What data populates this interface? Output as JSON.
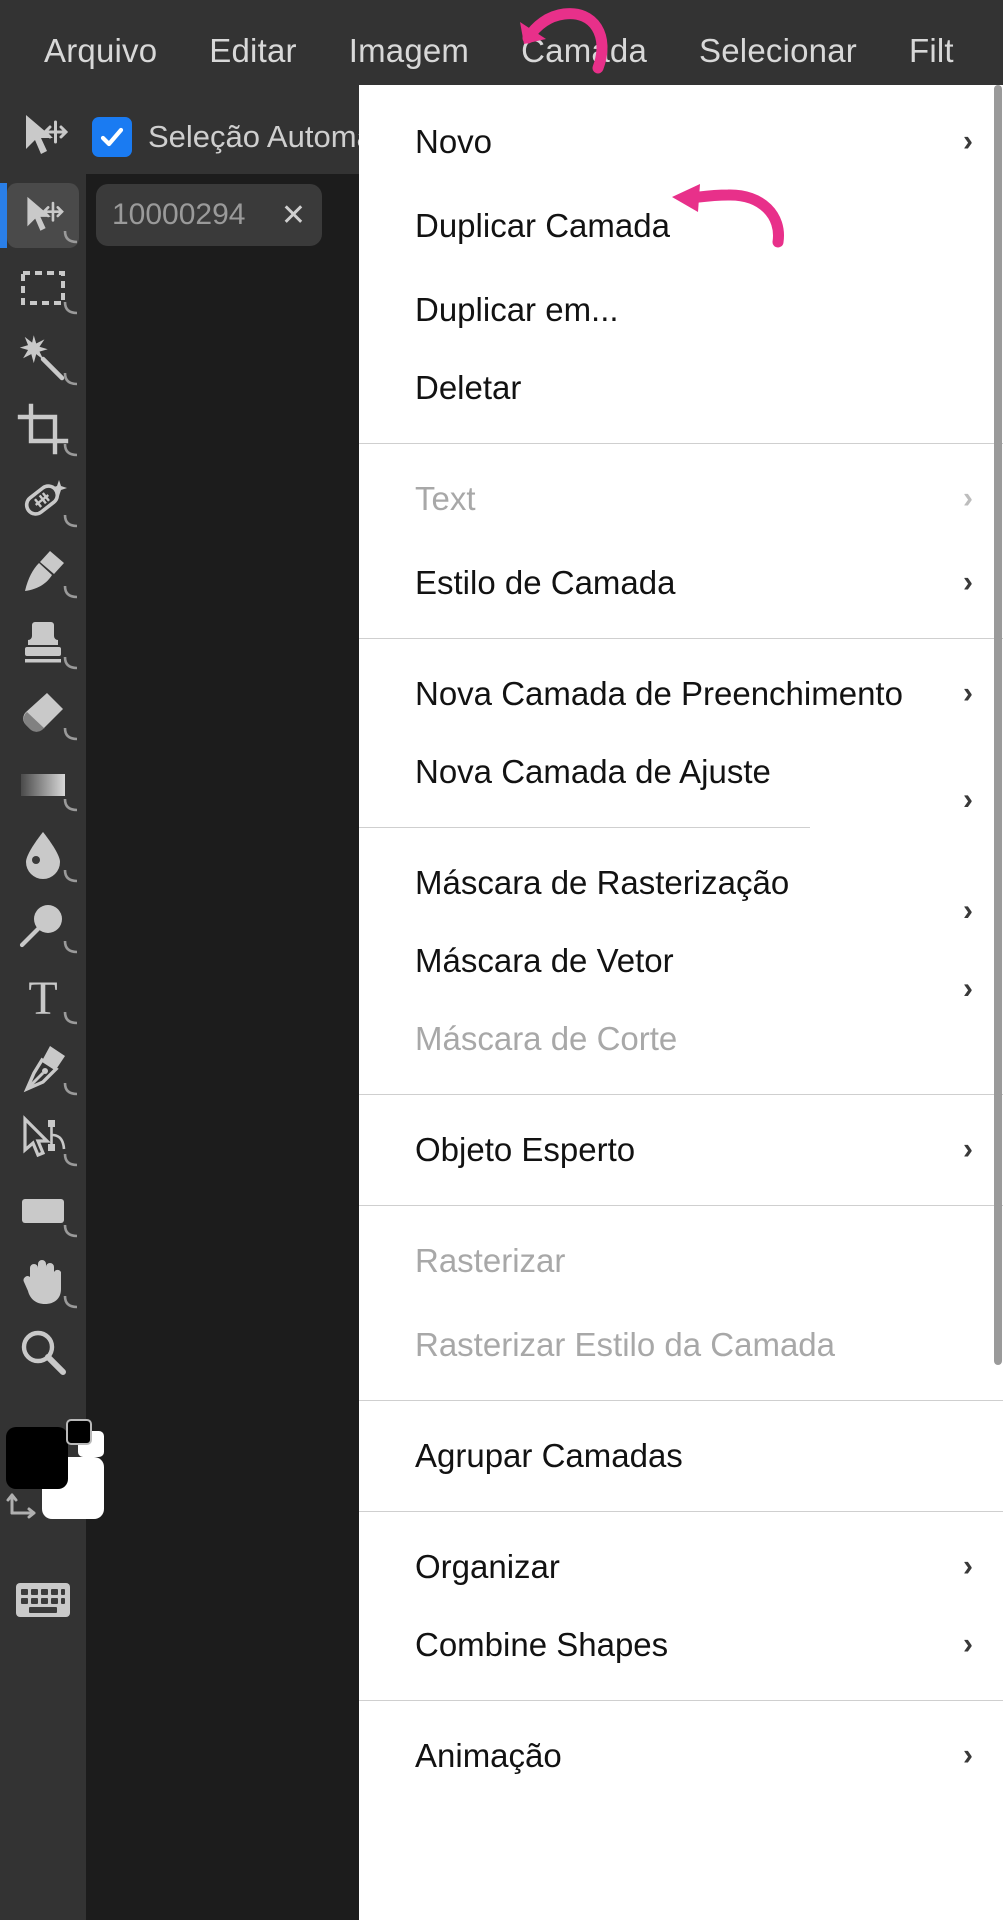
{
  "app": {
    "accent_blue": "#1a7bf2",
    "annotation_pink": "#e8308a",
    "menu_bg": "#ffffff",
    "chrome_bg": "#333333",
    "canvas_bg": "#1c1c1c"
  },
  "menubar": {
    "items": [
      {
        "label": "Arquivo",
        "name": "menu-arquivo"
      },
      {
        "label": "Editar",
        "name": "menu-editar"
      },
      {
        "label": "Imagem",
        "name": "menu-imagem"
      },
      {
        "label": "Camada",
        "name": "menu-camada"
      },
      {
        "label": "Selecionar",
        "name": "menu-selecionar"
      },
      {
        "label": "Filt",
        "name": "menu-filtro"
      }
    ]
  },
  "optionsbar": {
    "tool_icon": "move-tool-icon",
    "auto_select_label": "Seleção Automá",
    "auto_select_checked": true
  },
  "toolbar": {
    "tools": [
      {
        "icon": "move-tool-icon",
        "active": true
      },
      {
        "icon": "rectangular-marquee-icon",
        "active": false
      },
      {
        "icon": "magic-wand-icon",
        "active": false
      },
      {
        "icon": "crop-icon",
        "active": false
      },
      {
        "icon": "healing-brush-icon",
        "active": false
      },
      {
        "icon": "paintbrush-icon",
        "active": false
      },
      {
        "icon": "clone-stamp-icon",
        "active": false
      },
      {
        "icon": "eraser-icon",
        "active": false
      },
      {
        "icon": "gradient-icon",
        "active": false
      },
      {
        "icon": "blur-drop-icon",
        "active": false
      },
      {
        "icon": "dodge-icon",
        "active": false
      },
      {
        "icon": "text-tool-icon",
        "active": false
      },
      {
        "icon": "pen-tool-icon",
        "active": false
      },
      {
        "icon": "path-selection-icon",
        "active": false
      },
      {
        "icon": "shape-rectangle-icon",
        "active": false
      },
      {
        "icon": "hand-tool-icon",
        "active": false
      },
      {
        "icon": "zoom-tool-icon",
        "active": false
      }
    ],
    "foreground_color": "#000000",
    "background_color": "#ffffff",
    "swap_icon": "swap-colors-icon",
    "keyboard_icon": "keyboard-icon"
  },
  "canvas": {
    "layer_chip": {
      "name": "10000294",
      "close_icon": "close-icon"
    }
  },
  "dropdown": {
    "title": "Camada",
    "groups": [
      {
        "items": [
          {
            "label": "Novo",
            "submenu": true,
            "disabled": false
          },
          {
            "label": "Duplicar Camada",
            "submenu": false,
            "disabled": false
          },
          {
            "label": "Duplicar em...",
            "submenu": false,
            "disabled": false
          },
          {
            "label": "Deletar",
            "submenu": false,
            "disabled": false
          }
        ]
      },
      {
        "items": [
          {
            "label": "Text",
            "submenu": true,
            "disabled": true
          },
          {
            "label": "Estilo de Camada",
            "submenu": true,
            "disabled": false
          }
        ]
      },
      {
        "items": [
          {
            "label": "Nova Camada de Preenchimento",
            "submenu": true,
            "disabled": false
          },
          {
            "label": "Nova Camada de Ajuste",
            "submenu": true,
            "disabled": false
          }
        ]
      },
      {
        "items": [
          {
            "label": "Máscara de Rasterização",
            "submenu": true,
            "disabled": false
          },
          {
            "label": "Máscara de Vetor",
            "submenu": true,
            "disabled": false
          },
          {
            "label": "Máscara de Corte",
            "submenu": true,
            "disabled": true
          }
        ]
      },
      {
        "items": [
          {
            "label": "Objeto Esperto",
            "submenu": true,
            "disabled": false
          }
        ]
      },
      {
        "items": [
          {
            "label": "Rasterizar",
            "submenu": false,
            "disabled": true
          },
          {
            "label": "Rasterizar Estilo da Camada",
            "submenu": false,
            "disabled": true
          }
        ]
      },
      {
        "items": [
          {
            "label": "Agrupar Camadas",
            "submenu": false,
            "disabled": false
          }
        ]
      },
      {
        "items": [
          {
            "label": "Organizar",
            "submenu": true,
            "disabled": false
          },
          {
            "label": "Combine Shapes",
            "submenu": true,
            "disabled": false
          }
        ]
      },
      {
        "items": [
          {
            "label": "Animação",
            "submenu": true,
            "disabled": false
          }
        ]
      }
    ]
  },
  "annotations": [
    {
      "name": "arrow-to-camada-menu",
      "color": "#e8308a"
    },
    {
      "name": "arrow-to-duplicar-camada",
      "color": "#e8308a"
    }
  ]
}
